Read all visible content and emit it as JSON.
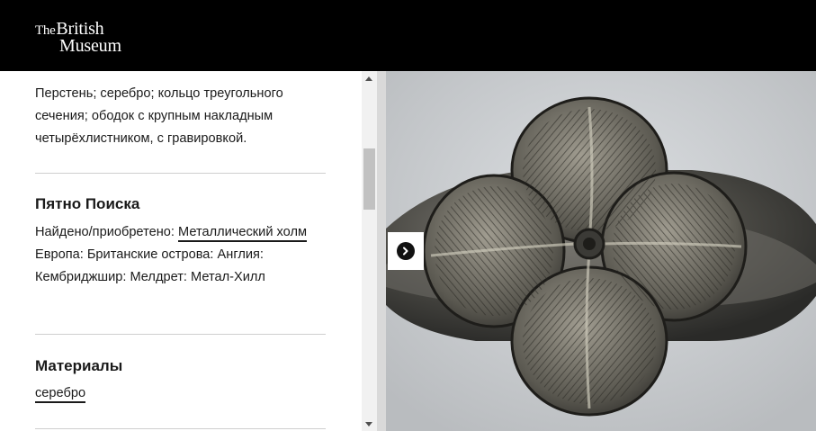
{
  "header": {
    "logo_the": "The",
    "logo_british": "British",
    "logo_museum": "Museum"
  },
  "description": "Перстень; серебро; кольцо треугольного сечения; ободок с крупным накладным четырёхлистником, с гравировкой.",
  "find_spot": {
    "heading": "Пятно Поиска",
    "found_label": "Найдено/приобретено:",
    "found_link": "Металлический холм",
    "location": "Европа: Британские острова: Англия: Кембриджшир: Мелдрет: Метал-Хилл"
  },
  "materials": {
    "heading": "Материалы",
    "link": "серебро"
  },
  "viewer": {
    "next_icon": "chevron-right-circle-icon"
  },
  "colors": {
    "header_bg": "#000000",
    "text": "#1a1a1a",
    "rule": "#cfcfcf"
  }
}
